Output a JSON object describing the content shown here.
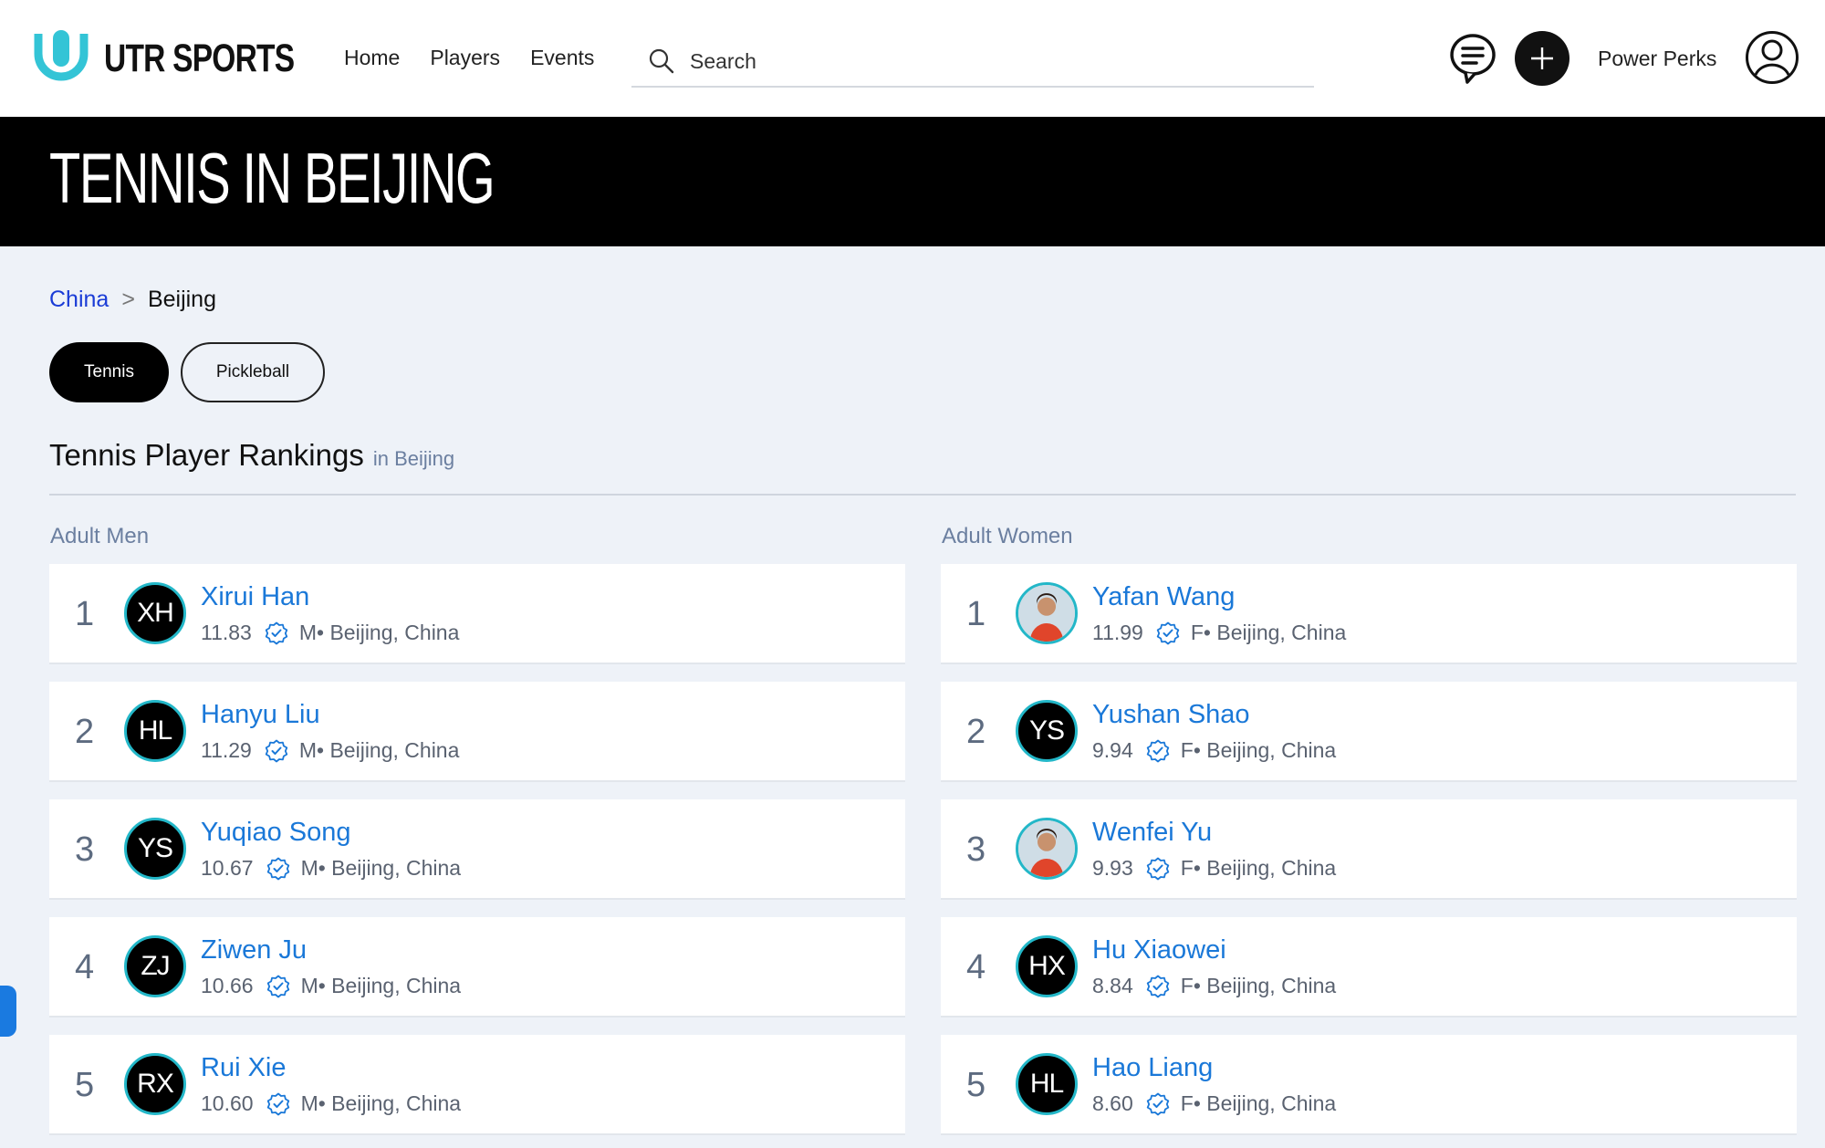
{
  "header": {
    "logo_text": "UTR SPORTS",
    "nav": [
      "Home",
      "Players",
      "Events"
    ],
    "search_placeholder": "Search",
    "power_perks": "Power Perks"
  },
  "hero": {
    "title": "TENNIS IN BEIJING"
  },
  "breadcrumb": {
    "country": "China",
    "separator": ">",
    "city": "Beijing"
  },
  "sport_tabs": {
    "tennis": "Tennis",
    "pickleball": "Pickleball",
    "active": "Tennis"
  },
  "rankings": {
    "title": "Tennis Player Rankings",
    "subtitle": "in Beijing",
    "men": {
      "heading": "Adult Men",
      "players": [
        {
          "rank": "1",
          "initials": "XH",
          "name": "Xirui Han",
          "rating": "11.83",
          "location": "M• Beijing, China"
        },
        {
          "rank": "2",
          "initials": "HL",
          "name": "Hanyu Liu",
          "rating": "11.29",
          "location": "M• Beijing, China"
        },
        {
          "rank": "3",
          "initials": "YS",
          "name": "Yuqiao Song",
          "rating": "10.67",
          "location": "M• Beijing, China"
        },
        {
          "rank": "4",
          "initials": "ZJ",
          "name": "Ziwen Ju",
          "rating": "10.66",
          "location": "M• Beijing, China"
        },
        {
          "rank": "5",
          "initials": "RX",
          "name": "Rui Xie",
          "rating": "10.60",
          "location": "M• Beijing, China"
        }
      ]
    },
    "women": {
      "heading": "Adult Women",
      "players": [
        {
          "rank": "1",
          "initials": "",
          "photo": true,
          "name": "Yafan Wang",
          "rating": "11.99",
          "location": "F• Beijing, China"
        },
        {
          "rank": "2",
          "initials": "YS",
          "name": "Yushan Shao",
          "rating": "9.94",
          "location": "F• Beijing, China"
        },
        {
          "rank": "3",
          "initials": "",
          "photo": true,
          "name": "Wenfei Yu",
          "rating": "9.93",
          "location": "F• Beijing, China"
        },
        {
          "rank": "4",
          "initials": "HX",
          "name": "Hu Xiaowei",
          "rating": "8.84",
          "location": "F• Beijing, China"
        },
        {
          "rank": "5",
          "initials": "HL",
          "name": "Hao Liang",
          "rating": "8.60",
          "location": "F• Beijing, China"
        }
      ]
    }
  },
  "colors": {
    "accent": "#1a78d8",
    "avatar_ring": "#23b7c8",
    "link": "#1a3cd6"
  }
}
